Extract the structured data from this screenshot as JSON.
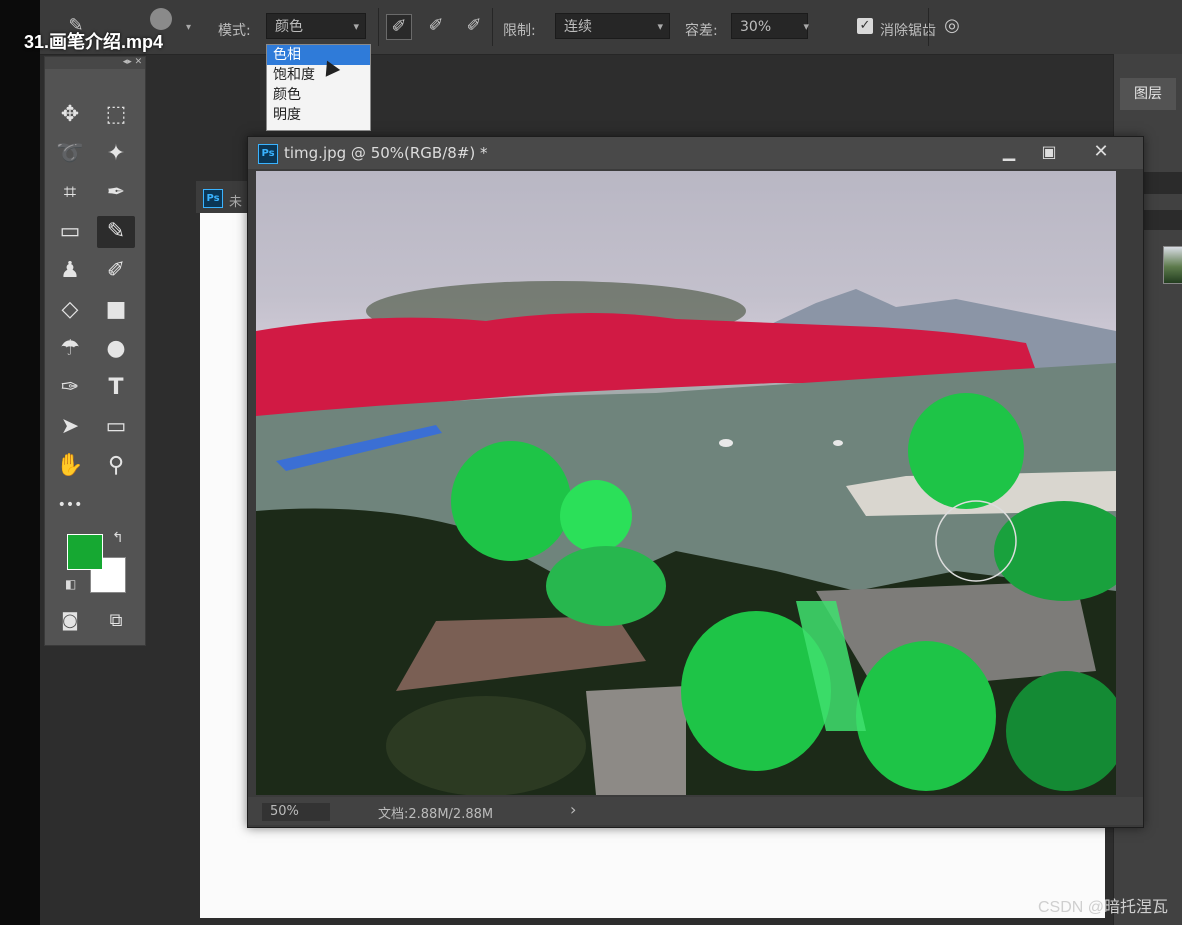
{
  "video_title": "31.画笔介绍.mp4",
  "options_bar": {
    "mode_label": "模式:",
    "mode_value": "颜色",
    "limit_label": "限制:",
    "limit_value": "连续",
    "tolerance_label": "容差:",
    "tolerance_value": "30%",
    "protect_label": "消除锯齿"
  },
  "mode_dropdown": {
    "items": [
      "色相",
      "饱和度",
      "颜色",
      "明度"
    ],
    "selected_index": 0
  },
  "toolbar": {
    "extra_label": "•••"
  },
  "right_panel": {
    "layers_tab": "图层"
  },
  "background_document": {
    "tab_label": "未"
  },
  "document": {
    "ps_badge": "Ps",
    "title": "timg.jpg @ 50%(RGB/8#) *",
    "zoom": "50%",
    "doc_info": "文档:2.88M/2.88M",
    "status_arrow": "›",
    "colors": {
      "foreground": "#16a832",
      "background": "#ffffff",
      "paint_red": "#d11a44",
      "paint_green": "#1ec447"
    }
  },
  "watermark": "CSDN @暗托涅瓦"
}
